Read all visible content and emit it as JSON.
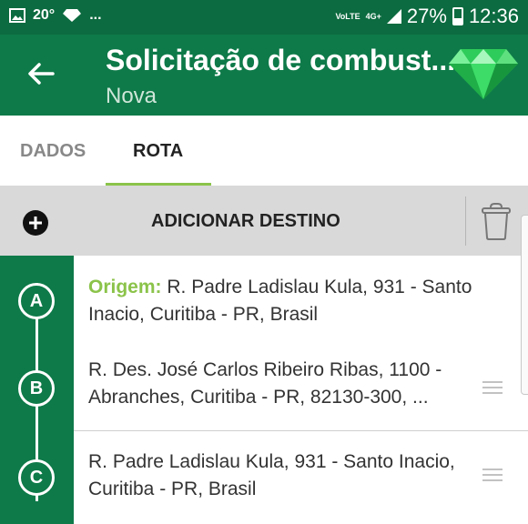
{
  "status_bar": {
    "temperature": "20°",
    "ellipsis": "...",
    "volte": "VoLTE",
    "network": "4G+",
    "battery": "27%",
    "time": "12:36"
  },
  "app_bar": {
    "title": "Solicitação de combust...",
    "subtitle": "Nova"
  },
  "tabs": [
    {
      "label": "DADOS",
      "active": false
    },
    {
      "label": "ROTA",
      "active": true
    }
  ],
  "toolbar": {
    "add_label": "ADICIONAR DESTINO"
  },
  "route": {
    "stops": [
      {
        "marker": "A",
        "prefix": "Origem:",
        "address": "R. Padre Ladislau Kula, 931 - Santo Inacio, Curitiba - PR, Brasil"
      },
      {
        "marker": "B",
        "address": "R. Des. José Carlos Ribeiro Ribas, 1100 - Abranches, Curitiba - PR, 82130-300, ..."
      },
      {
        "marker": "C",
        "address": "R. Padre Ladislau Kula, 931 - Santo Inacio, Curitiba - PR, Brasil"
      }
    ]
  },
  "colors": {
    "status_bar": "#0c6b40",
    "primary": "#0e7a49",
    "accent": "#8bc34a",
    "toolbar_bg": "#d9d9d9"
  },
  "icons": [
    "gallery-icon",
    "diamond-small-icon",
    "back-arrow-icon",
    "emerald-logo-icon",
    "add-circle-icon",
    "trash-icon",
    "drag-handle-icon"
  ]
}
